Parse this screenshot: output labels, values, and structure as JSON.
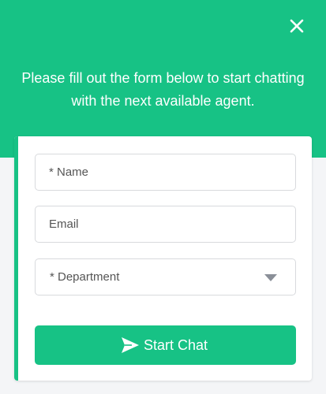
{
  "colors": {
    "brand_green": "#17c285",
    "background": "#f4f5f7",
    "field_border": "#d8dadd",
    "caret": "#8a8f98"
  },
  "header": {
    "intro_text": "Please fill out the form below to start chatting with the next available agent.",
    "close_icon": "close-icon"
  },
  "form": {
    "name_placeholder": "* Name",
    "email_placeholder": "Email",
    "department_label": "* Department",
    "department_icon": "chevron-down-icon"
  },
  "submit": {
    "label": "Start Chat",
    "icon": "send-icon"
  }
}
